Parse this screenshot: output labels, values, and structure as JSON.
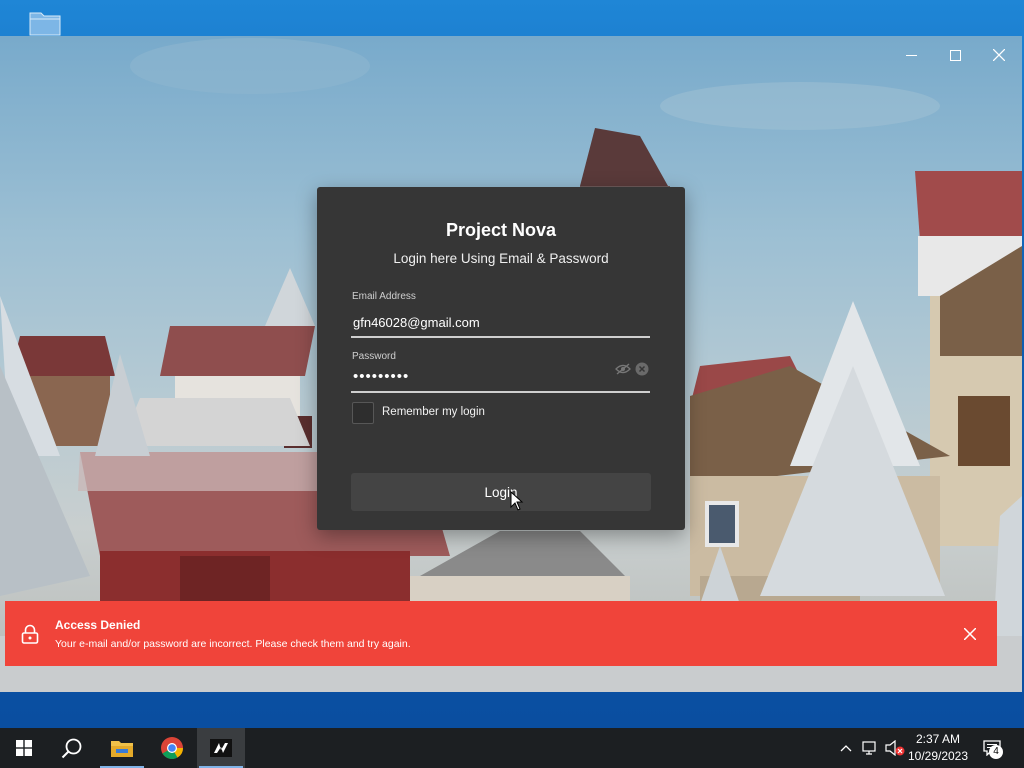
{
  "window": {
    "minimize_glyph": "—",
    "maximize_glyph": "☐",
    "close_glyph": "✕"
  },
  "login": {
    "title": "Project Nova",
    "subtitle": "Login here Using Email & Password",
    "email_label": "Email Address",
    "email_value": "gfn46028@gmail.com",
    "password_label": "Password",
    "password_value": "•••••••••",
    "remember_label": "Remember my login",
    "remember_checked": false,
    "login_button": "Login"
  },
  "error": {
    "title": "Access Denied",
    "message": "Your e-mail and/or password are incorrect. Please check them and try again.",
    "color": "#f0443a"
  },
  "taskbar": {
    "pinned": [
      "start-icon",
      "search-icon",
      "file-explorer-icon",
      "chrome-icon",
      "nova-launcher-icon"
    ],
    "time": "2:37 AM",
    "date": "10/29/2023",
    "notification_count": "4"
  }
}
